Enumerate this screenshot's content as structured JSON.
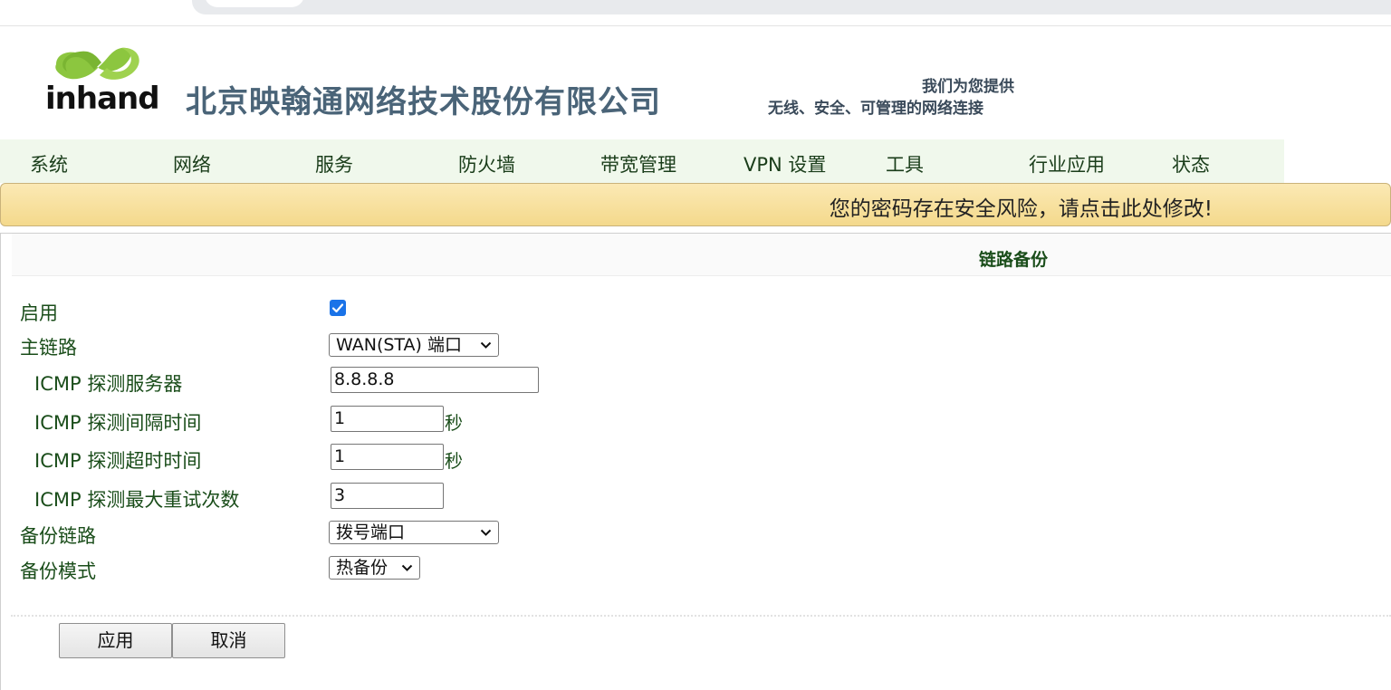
{
  "header": {
    "logo_text": "inhand",
    "company_name": "北京映翰通网络技术股份有限公司",
    "slogan_line1": "我们为您提供",
    "slogan_line2": "无线、安全、可管理的网络连接"
  },
  "nav": {
    "items": [
      {
        "label": "系统"
      },
      {
        "label": "网络"
      },
      {
        "label": "服务"
      },
      {
        "label": "防火墙"
      },
      {
        "label": "带宽管理"
      },
      {
        "label": "VPN 设置"
      },
      {
        "label": "工具"
      },
      {
        "label": "行业应用"
      },
      {
        "label": "状态"
      }
    ]
  },
  "banner": {
    "text": "您的密码存在安全风险，请点击此处修改!"
  },
  "panel": {
    "title": "链路备份"
  },
  "form": {
    "enable": {
      "label": "启用",
      "checked": true
    },
    "primary_link": {
      "label": "主链路",
      "value": "WAN(STA) 端口"
    },
    "icmp_server": {
      "label": "ICMP 探测服务器",
      "value": "8.8.8.8"
    },
    "icmp_interval": {
      "label": "ICMP 探测间隔时间",
      "value": "1",
      "unit": "秒"
    },
    "icmp_timeout": {
      "label": "ICMP 探测超时时间",
      "value": "1",
      "unit": "秒"
    },
    "icmp_retries": {
      "label": "ICMP 探测最大重试次数",
      "value": "3"
    },
    "backup_link": {
      "label": "备份链路",
      "value": "拨号端口"
    },
    "backup_mode": {
      "label": "备份模式",
      "value": "热备份"
    }
  },
  "buttons": {
    "apply": "应用",
    "cancel": "取消"
  },
  "colors": {
    "nav_bg": "#f0f8ec",
    "label_green": "#1a4d1a",
    "banner_bg": "#f4d98c",
    "checkbox_blue": "#1a73e8",
    "logo_green": "#8cc63f"
  }
}
